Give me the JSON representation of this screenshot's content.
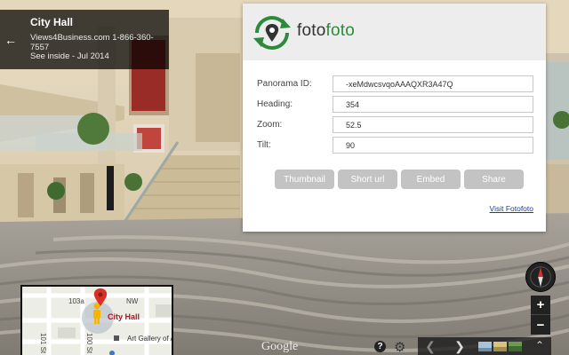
{
  "location": {
    "title": "City Hall",
    "contact": "Views4Business.com 1-866-360-7557",
    "inside_date": "See inside - Jul 2014"
  },
  "popup": {
    "logo_prefix": "foto",
    "logo_suffix": "foto",
    "fields": [
      {
        "label": "Panorama ID:",
        "value": "-xeMdwcsvqoAAAQXR3A47Q"
      },
      {
        "label": "Heading:",
        "value": "354"
      },
      {
        "label": "Zoom:",
        "value": "52.5"
      },
      {
        "label": "Tilt:",
        "value": "90"
      }
    ],
    "buttons": [
      "Thumbnail",
      "Short url",
      "Embed",
      "Share"
    ],
    "visit_link": "Visit Fotofoto"
  },
  "map": {
    "place_label": "City Hall",
    "poi_label": "Art Gallery of A",
    "streets": [
      "103a",
      "101 St",
      "100 St",
      "NW"
    ]
  },
  "controls": {
    "google_label": "Google",
    "help_label": "?",
    "zoom_in_label": "+",
    "zoom_out_label": "−"
  },
  "icons": {
    "back": "arrow-left-icon",
    "help": "help-icon",
    "gear": "gear-icon",
    "prev": "chevron-left-icon",
    "next": "chevron-right-icon",
    "expand": "expand-icon",
    "compass": "compass-icon",
    "pegman": "pegman-icon",
    "marker": "map-marker-icon"
  },
  "colors": {
    "brand_green": "#2d8a3c",
    "button_gray": "#c3c3c3",
    "link_blue": "#1a3d9c",
    "compass_red": "#d32f2f"
  }
}
